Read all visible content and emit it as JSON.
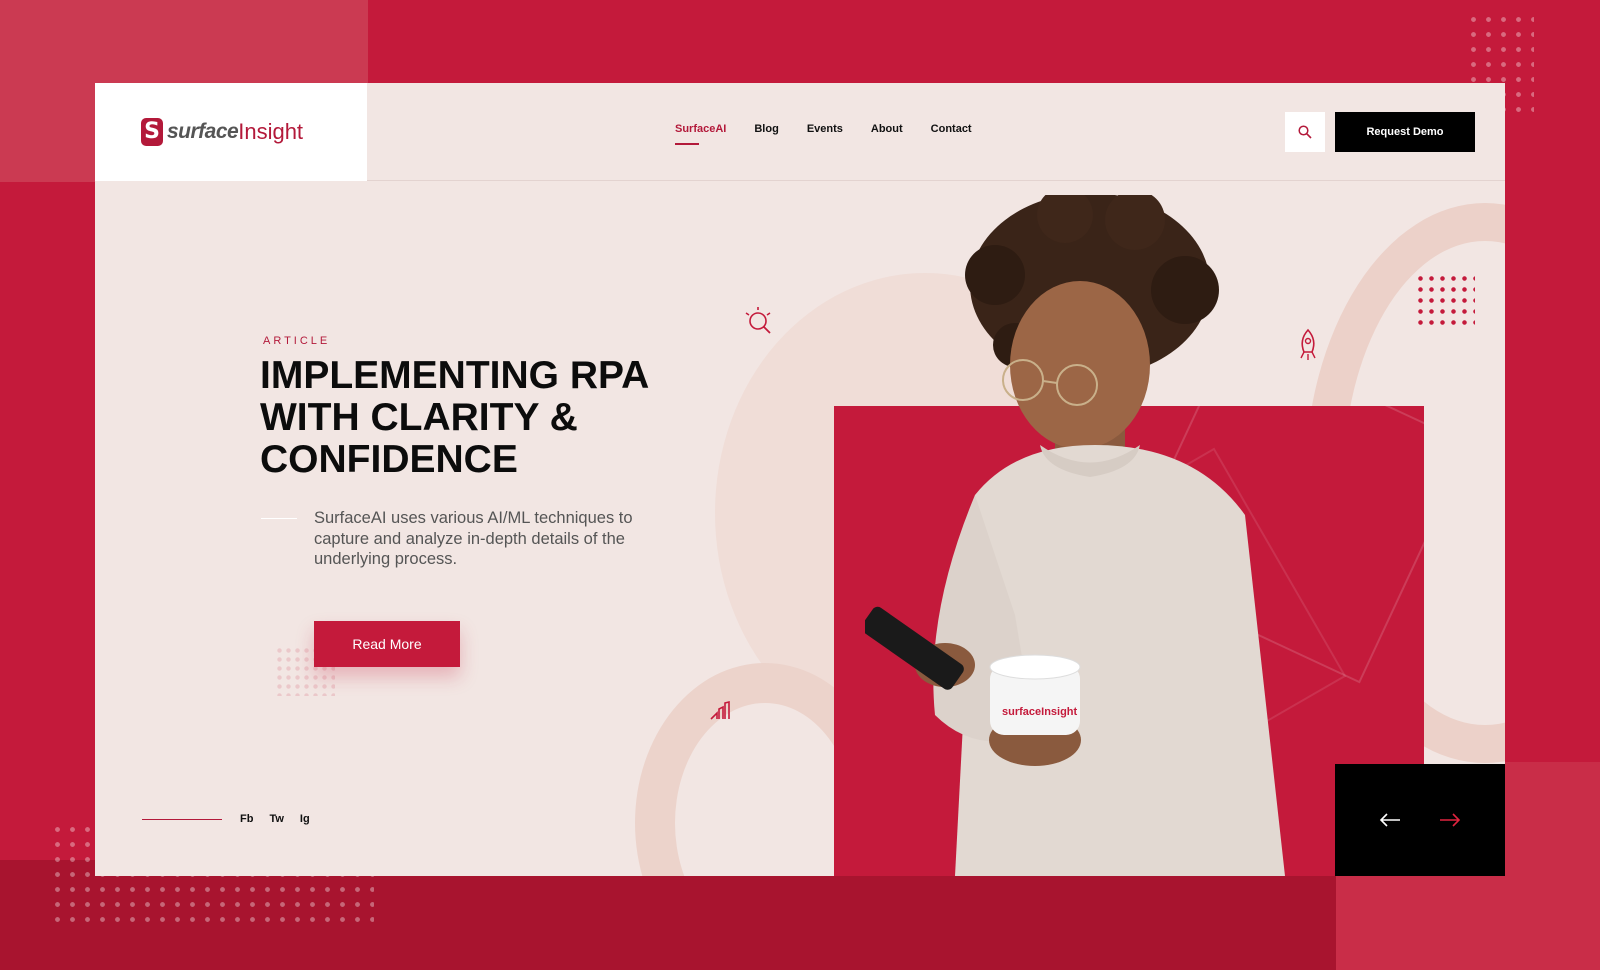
{
  "brand": {
    "mark": "S",
    "name_part1": "surface",
    "name_part2": "Insight"
  },
  "nav": {
    "items": [
      {
        "label": "SurfaceAI",
        "active": true
      },
      {
        "label": "Blog",
        "active": false
      },
      {
        "label": "Events",
        "active": false
      },
      {
        "label": "About",
        "active": false
      },
      {
        "label": "Contact",
        "active": false
      }
    ]
  },
  "header": {
    "search_icon": "search-icon",
    "cta_label": "Request Demo"
  },
  "hero": {
    "kicker": "ARTICLE",
    "headline": "IMPLEMENTING RPA WITH CLARITY & CONFIDENCE",
    "lede": "SurfaceAI uses various AI/ML techniques to capture and analyze in-depth details of the underlying process.",
    "button_label": "Read More",
    "mug_brand": "surfaceInsight"
  },
  "social": {
    "links": [
      "Fb",
      "Tw",
      "Ig"
    ]
  },
  "slider": {
    "prev_icon": "arrow-left-icon",
    "next_icon": "arrow-right-icon"
  },
  "colors": {
    "accent": "#c41a3b",
    "card_bg": "#f2e6e3",
    "dark": "#000000"
  }
}
